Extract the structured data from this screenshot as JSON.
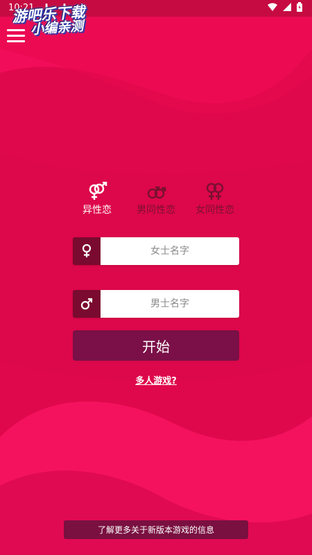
{
  "status_bar": {
    "time": "10:21",
    "notification_icons": "⬇ ⬇ A"
  },
  "watermark": {
    "line1": "游吧乐下载",
    "line2": "小编亲测"
  },
  "modes": [
    {
      "label": "异性恋",
      "icon": "male-female-icon",
      "selected": true
    },
    {
      "label": "男同性恋",
      "icon": "male-male-icon",
      "selected": false
    },
    {
      "label": "女同性恋",
      "icon": "female-female-icon",
      "selected": false
    }
  ],
  "inputs": {
    "female_name": {
      "placeholder": "女士名字",
      "value": "",
      "icon": "female-icon"
    },
    "male_name": {
      "placeholder": "男士名字",
      "value": "",
      "icon": "male-icon"
    }
  },
  "start_button": {
    "label": "开始"
  },
  "multiplayer_link": {
    "label": "多人游戏?"
  },
  "info_bar": {
    "label": "了解更多关于新版本游戏的信息"
  },
  "colors": {
    "background": "#e3094f",
    "accent_dark": "#7a0a2f",
    "button": "#7a1047",
    "status_bar": "#c60a42"
  }
}
